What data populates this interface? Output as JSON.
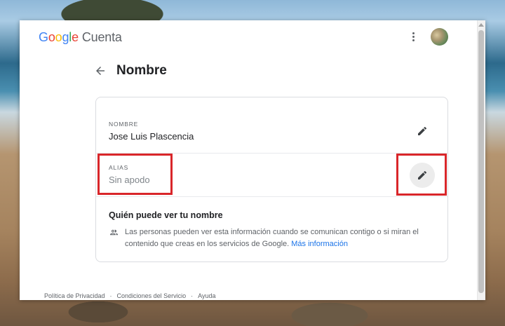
{
  "header": {
    "logo_letters": [
      "G",
      "o",
      "o",
      "g",
      "l",
      "e"
    ],
    "product": "Cuenta",
    "more_icon": "more-vert-icon",
    "avatar_icon": "avatar"
  },
  "page": {
    "title": "Nombre",
    "back_icon": "arrow-back-icon"
  },
  "card": {
    "name": {
      "label": "NOMBRE",
      "value": "Jose Luis Plascencia",
      "edit_icon": "pencil-icon"
    },
    "alias": {
      "label": "ALIAS",
      "placeholder": "Sin apodo",
      "edit_icon": "pencil-icon"
    },
    "info": {
      "title": "Quién puede ver tu nombre",
      "icon": "people-icon",
      "text": "Las personas pueden ver esta información cuando se comunican contigo o si miran el contenido que creas en los servicios de Google.",
      "link": "Más información"
    }
  },
  "footer": {
    "links": [
      "Política de Privacidad",
      "Condiciones del Servicio",
      "Ayuda"
    ],
    "separator": "·"
  },
  "colors": {
    "accent": "#1a73e8",
    "highlight": "#d9262a",
    "google_blue": "#4285f4",
    "google_red": "#ea4335",
    "google_yellow": "#fbbc05",
    "google_green": "#34a853"
  }
}
